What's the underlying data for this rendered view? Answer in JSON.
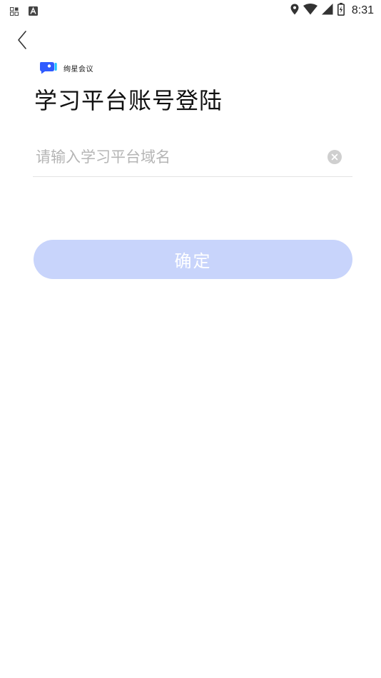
{
  "status_bar": {
    "time": "8:31",
    "left_icons": [
      "grid-notification-icon",
      "a-notification-icon"
    ],
    "right_icons": [
      "location-icon",
      "wifi-icon",
      "signal-icon",
      "battery-charging-icon"
    ]
  },
  "nav": {
    "back_icon": "chevron-left-icon"
  },
  "brand": {
    "name": "绚星会议",
    "logo_color": "#2f5bff",
    "logo_accent": "#1fc3ff"
  },
  "title": "学习平台账号登陆",
  "domain_input": {
    "value": "",
    "placeholder": "请输入学习平台域名",
    "clear_icon": "clear-circle-icon"
  },
  "confirm_button": {
    "label": "确定",
    "color": "#c8d4fb"
  }
}
